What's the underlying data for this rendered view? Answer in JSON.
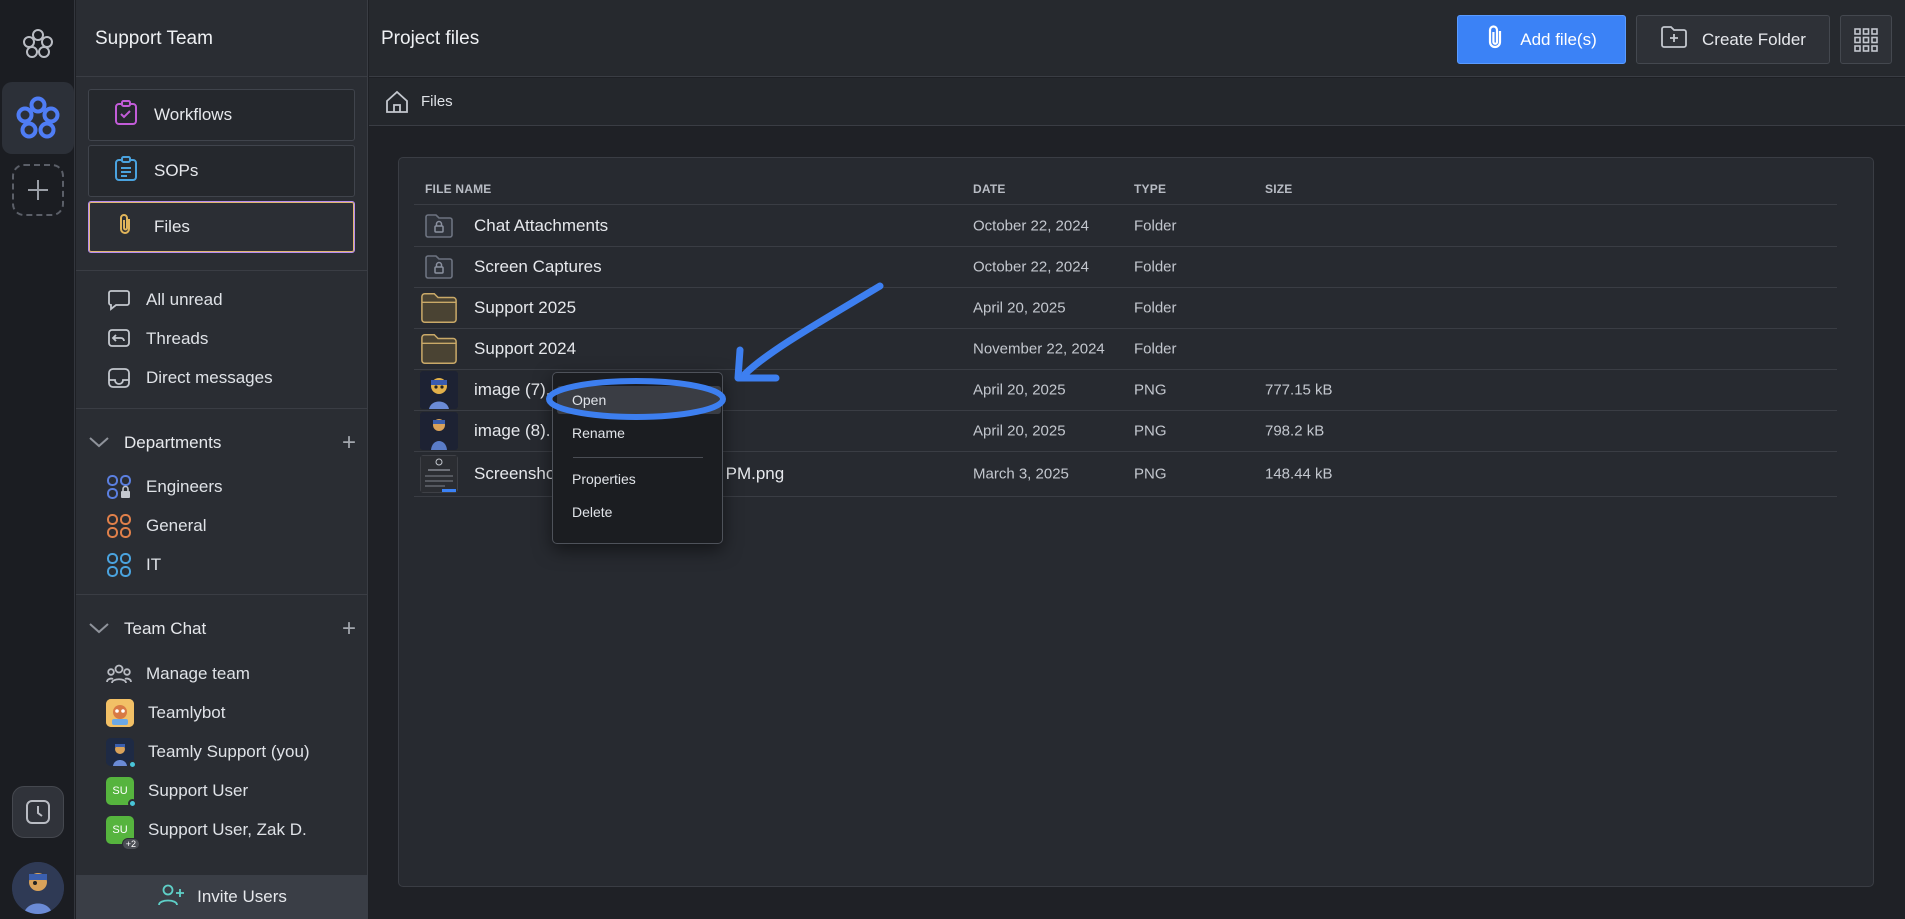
{
  "sidebar": {
    "title": "Support Team",
    "nav": [
      {
        "label": "Workflows",
        "icon": "clipboard-check-icon"
      },
      {
        "label": "SOPs",
        "icon": "clipboard-list-icon"
      },
      {
        "label": "Files",
        "icon": "paperclip-icon"
      }
    ],
    "quick": [
      {
        "label": "All unread",
        "icon": "chat-bubble-icon"
      },
      {
        "label": "Threads",
        "icon": "threads-icon"
      },
      {
        "label": "Direct messages",
        "icon": "inbox-icon"
      }
    ],
    "departments": {
      "label": "Departments",
      "items": [
        {
          "label": "Engineers",
          "icon": "engineers-group-icon"
        },
        {
          "label": "General",
          "icon": "general-group-icon"
        },
        {
          "label": "IT",
          "icon": "it-group-icon"
        }
      ]
    },
    "team_chat": {
      "label": "Team Chat",
      "items": [
        {
          "label": "Manage team",
          "icon": "people-icon"
        },
        {
          "label": "Teamlybot",
          "avatar": ""
        },
        {
          "label": "Teamly Support (you)",
          "avatar": ""
        },
        {
          "label": "Support User",
          "avatar": "SU"
        },
        {
          "label": "Support User, Zak D.",
          "avatar": "SU",
          "badge": "+2"
        }
      ]
    },
    "invite_label": "Invite Users"
  },
  "header": {
    "title": "Project files",
    "add_label": "Add file(s)",
    "folder_label": "Create Folder"
  },
  "breadcrumb": {
    "label": "Files"
  },
  "table": {
    "columns": [
      "FILE NAME",
      "DATE",
      "TYPE",
      "SIZE"
    ],
    "rows": [
      {
        "name": "Chat Attachments",
        "date": "October 22, 2024",
        "type": "Folder",
        "size": "",
        "icon": "locked-folder-icon"
      },
      {
        "name": "Screen Captures",
        "date": "October 22, 2024",
        "type": "Folder",
        "size": "",
        "icon": "locked-folder-icon"
      },
      {
        "name": "Support 2025",
        "date": "April 20, 2025",
        "type": "Folder",
        "size": "",
        "icon": "folder-icon"
      },
      {
        "name": "Support 2024",
        "date": "November 22, 2024",
        "type": "Folder",
        "size": "",
        "icon": "folder-icon"
      },
      {
        "name": "image (7).",
        "date": "April 20, 2025",
        "type": "PNG",
        "size": "777.15 kB",
        "icon": "image-thumbnail"
      },
      {
        "name": "image (8).",
        "date": "April 20, 2025",
        "type": "PNG",
        "size": "798.2 kB",
        "icon": "image-thumbnail"
      },
      {
        "name": "Screensho",
        "name_tail": "50 PM.png",
        "date": "March 3, 2025",
        "type": "PNG",
        "size": "148.44 kB",
        "icon": "screenshot-thumbnail"
      }
    ]
  },
  "context_menu": {
    "items": [
      "Open",
      "Rename",
      "Properties",
      "Delete"
    ]
  },
  "colors": {
    "accent": "#3b82f6",
    "annotation": "#3d7ff0",
    "folder": "#c9a968"
  }
}
